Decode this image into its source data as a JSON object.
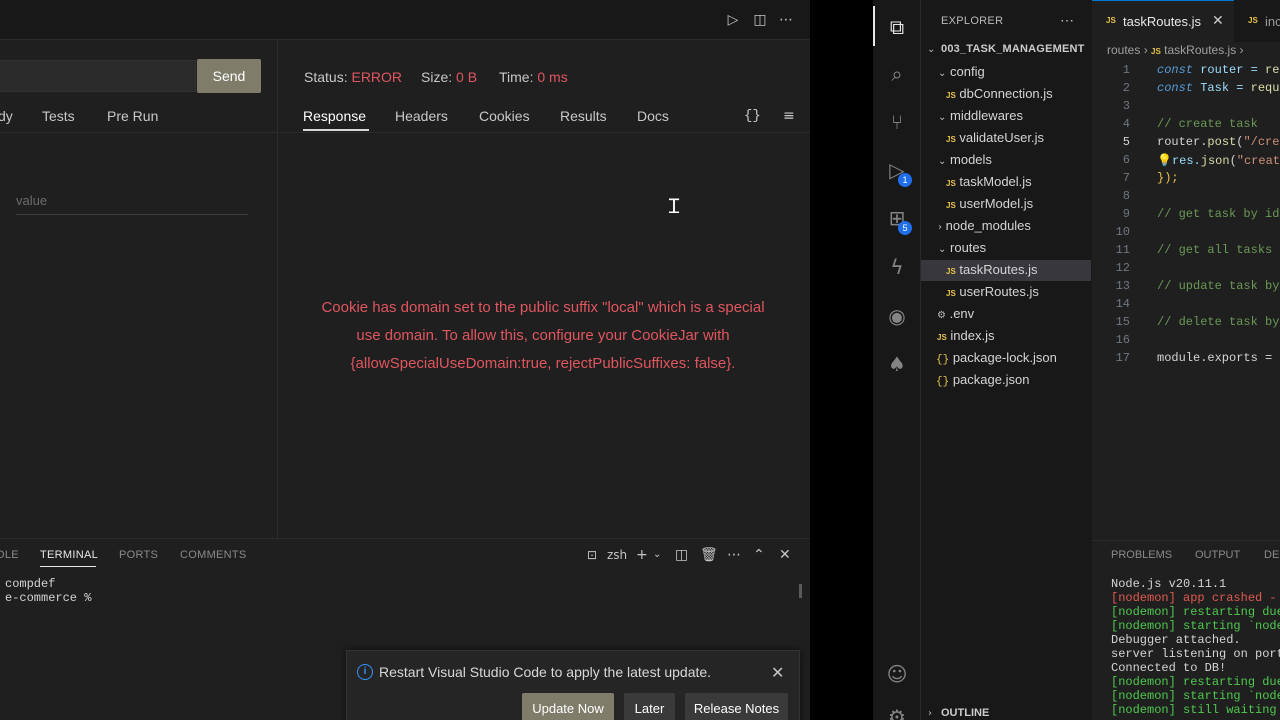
{
  "left": {
    "send_label": "Send",
    "req_tabs": [
      "dy",
      "Tests",
      "Pre Run"
    ],
    "value_placeholder": "value",
    "status": {
      "label": "Status:",
      "value": "ERROR",
      "size_label": "Size:",
      "size_value": "0 B",
      "time_label": "Time:",
      "time_value": "0 ms"
    },
    "resp_tabs": [
      "Response",
      "Headers",
      "Cookies",
      "Results",
      "Docs"
    ],
    "braces_icon": "{}",
    "error_lines": [
      "Cookie has domain set to the public suffix \"local\" which is a special",
      "use domain. To allow this, configure your CookieJar with",
      "{allowSpecialUseDomain:true, rejectPublicSuffixes: false}."
    ],
    "panel_tabs": [
      "OLE",
      "TERMINAL",
      "PORTS",
      "COMMENTS"
    ],
    "shell": "zsh",
    "terminal_lines": [
      "compdef",
      "e-commerce %"
    ],
    "notification": {
      "text": "Restart Visual Studio Code to apply the latest update.",
      "update": "Update Now",
      "later": "Later",
      "release": "Release Notes"
    }
  },
  "right": {
    "explorer_title": "EXPLORER",
    "project": "003_TASK_MANAGEMENT",
    "tree": {
      "config": "config",
      "db": "dbConnection.js",
      "middlewares": "middlewares",
      "validate": "validateUser.js",
      "models": "models",
      "taskModel": "taskModel.js",
      "userModel": "userModel.js",
      "node_modules": "node_modules",
      "routes": "routes",
      "taskRoutes": "taskRoutes.js",
      "userRoutes": "userRoutes.js",
      "env": ".env",
      "index": "index.js",
      "lock": "package-lock.json",
      "pkg": "package.json"
    },
    "outline": "OUTLINE",
    "badges": {
      "debug": "1",
      "extensions": "5"
    },
    "tabs": [
      "taskRoutes.js",
      "inc"
    ],
    "breadcrumb": [
      "routes",
      "taskRoutes.js"
    ],
    "line_numbers": [
      "1",
      "2",
      "3",
      "4",
      "5",
      "6",
      "7",
      "8",
      "9",
      "10",
      "11",
      "12",
      "13",
      "14",
      "15",
      "16",
      "17"
    ],
    "code": {
      "l1a": "const",
      "l1b": " router = ",
      "l1c": "re",
      "l2a": "const",
      "l2b": " Task = ",
      "l2c": "requ",
      "l4": "// create task",
      "l5a": "router.",
      "l5b": "post",
      "l5c": "(",
      "l5d": "\"/cre",
      "l6a": "res.",
      "l6b": "json",
      "l6c": "(",
      "l6d": "\"creat",
      "l7": "});",
      "l9": "// get task by id",
      "l11": "// get all tasks",
      "l13": "// update task by",
      "l15": "// delete task by",
      "l17a": "module.exports",
      "l17b": " ="
    },
    "panel_tabs": [
      "PROBLEMS",
      "OUTPUT",
      "DE"
    ],
    "terminal": [
      "Node.js v20.11.1",
      "[nodemon] app crashed -",
      "[nodemon] restarting due",
      "[nodemon] starting `node",
      "Debugger attached.",
      "server listening on port",
      "Connected to DB!",
      "[nodemon] restarting due",
      "[nodemon] starting `node",
      "[nodemon] still waiting"
    ]
  },
  "colors": {
    "error": "#e0565f",
    "accent_button": "#7f7d6a",
    "link_blue": "#3794ff"
  }
}
